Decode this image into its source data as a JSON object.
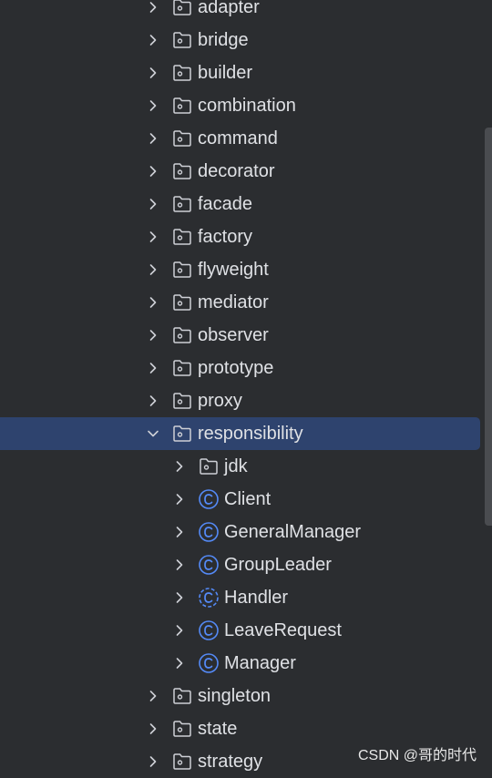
{
  "tree": {
    "items": [
      {
        "label": "adapter",
        "kind": "package",
        "level": 1,
        "expanded": false,
        "selected": false
      },
      {
        "label": "bridge",
        "kind": "package",
        "level": 1,
        "expanded": false,
        "selected": false
      },
      {
        "label": "builder",
        "kind": "package",
        "level": 1,
        "expanded": false,
        "selected": false
      },
      {
        "label": "combination",
        "kind": "package",
        "level": 1,
        "expanded": false,
        "selected": false
      },
      {
        "label": "command",
        "kind": "package",
        "level": 1,
        "expanded": false,
        "selected": false
      },
      {
        "label": "decorator",
        "kind": "package",
        "level": 1,
        "expanded": false,
        "selected": false
      },
      {
        "label": "facade",
        "kind": "package",
        "level": 1,
        "expanded": false,
        "selected": false
      },
      {
        "label": "factory",
        "kind": "package",
        "level": 1,
        "expanded": false,
        "selected": false
      },
      {
        "label": "flyweight",
        "kind": "package",
        "level": 1,
        "expanded": false,
        "selected": false
      },
      {
        "label": "mediator",
        "kind": "package",
        "level": 1,
        "expanded": false,
        "selected": false
      },
      {
        "label": "observer",
        "kind": "package",
        "level": 1,
        "expanded": false,
        "selected": false
      },
      {
        "label": "prototype",
        "kind": "package",
        "level": 1,
        "expanded": false,
        "selected": false
      },
      {
        "label": "proxy",
        "kind": "package",
        "level": 1,
        "expanded": false,
        "selected": false
      },
      {
        "label": "responsibility",
        "kind": "package",
        "level": 1,
        "expanded": true,
        "selected": true
      },
      {
        "label": "jdk",
        "kind": "package",
        "level": 2,
        "expanded": false,
        "selected": false
      },
      {
        "label": "Client",
        "kind": "class",
        "level": 2,
        "expanded": false,
        "selected": false
      },
      {
        "label": "GeneralManager",
        "kind": "class",
        "level": 2,
        "expanded": false,
        "selected": false
      },
      {
        "label": "GroupLeader",
        "kind": "class",
        "level": 2,
        "expanded": false,
        "selected": false
      },
      {
        "label": "Handler",
        "kind": "abstract-class",
        "level": 2,
        "expanded": false,
        "selected": false
      },
      {
        "label": "LeaveRequest",
        "kind": "class",
        "level": 2,
        "expanded": false,
        "selected": false
      },
      {
        "label": "Manager",
        "kind": "class",
        "level": 2,
        "expanded": false,
        "selected": false
      },
      {
        "label": "singleton",
        "kind": "package",
        "level": 1,
        "expanded": false,
        "selected": false
      },
      {
        "label": "state",
        "kind": "package",
        "level": 1,
        "expanded": false,
        "selected": false
      },
      {
        "label": "strategy",
        "kind": "package",
        "level": 1,
        "expanded": false,
        "selected": false
      }
    ]
  },
  "watermark": "CSDN @哥的时代",
  "colors": {
    "background": "#2b2d30",
    "selection": "#2e436e",
    "text": "#dfe1e5",
    "icon_gray": "#ced0d6",
    "class_blue": "#548af7"
  }
}
